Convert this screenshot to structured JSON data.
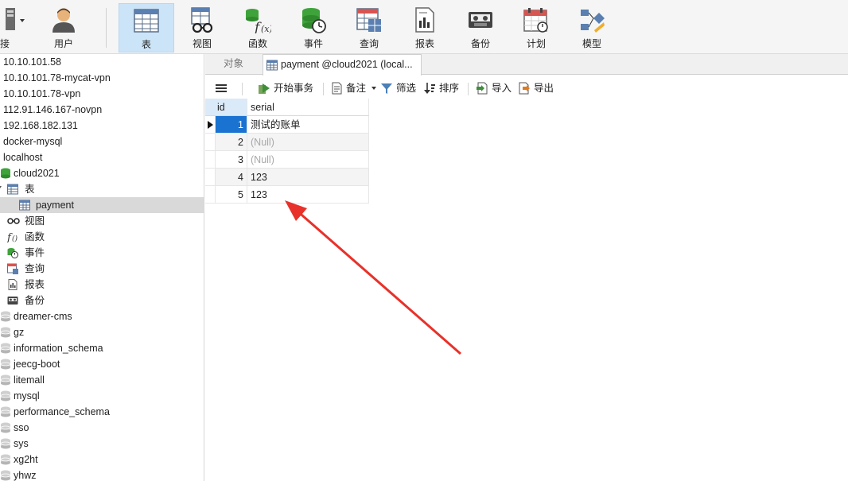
{
  "toolbar": {
    "items": [
      {
        "id": "connect",
        "label": "连接",
        "shown": "接"
      },
      {
        "id": "user",
        "label": "用户"
      },
      {
        "id": "table",
        "label": "表"
      },
      {
        "id": "view",
        "label": "视图"
      },
      {
        "id": "function",
        "label": "函数"
      },
      {
        "id": "event",
        "label": "事件"
      },
      {
        "id": "query",
        "label": "查询"
      },
      {
        "id": "report",
        "label": "报表"
      },
      {
        "id": "backup",
        "label": "备份"
      },
      {
        "id": "schedule",
        "label": "计划"
      },
      {
        "id": "model",
        "label": "模型"
      }
    ],
    "active": "table"
  },
  "sidebar": {
    "connections": [
      "10.10.101.58",
      "10.10.101.78-mycat-vpn",
      "10.10.101.78-vpn",
      "112.91.146.167-novpn",
      "192.168.182.131",
      "docker-mysql",
      "localhost"
    ],
    "open_database": "cloud2021",
    "tree": {
      "tables_label": "表",
      "table_item": "payment",
      "views_label": "视图",
      "functions_label": "函数",
      "events_label": "事件",
      "queries_label": "查询",
      "reports_label": "报表",
      "backups_label": "备份"
    },
    "other_databases": [
      "dreamer-cms",
      "gz",
      "information_schema",
      "jeecg-boot",
      "litemall",
      "mysql",
      "performance_schema",
      "sso",
      "sys",
      "xg2ht",
      "yhwz"
    ]
  },
  "tabs": {
    "objects": "对象",
    "payment": "payment @cloud2021 (local..."
  },
  "subtoolbar": {
    "menu": "",
    "begin_transaction": "开始事务",
    "notes": "备注",
    "filter": "筛选",
    "sort": "排序",
    "import": "导入",
    "export": "导出"
  },
  "grid": {
    "columns": [
      "id",
      "serial"
    ],
    "rows": [
      {
        "id": "1",
        "serial": "测试的账单",
        "null": false
      },
      {
        "id": "2",
        "serial": "(Null)",
        "null": true
      },
      {
        "id": "3",
        "serial": "(Null)",
        "null": true
      },
      {
        "id": "4",
        "serial": "123",
        "null": false
      },
      {
        "id": "5",
        "serial": "123",
        "null": false
      }
    ],
    "selected_row": 0
  },
  "colors": {
    "accent_blue": "#1a73d1",
    "active_tool_bg": "#cce4f7",
    "db_green": "#3ea33a",
    "arrow_red": "#e8312a"
  }
}
